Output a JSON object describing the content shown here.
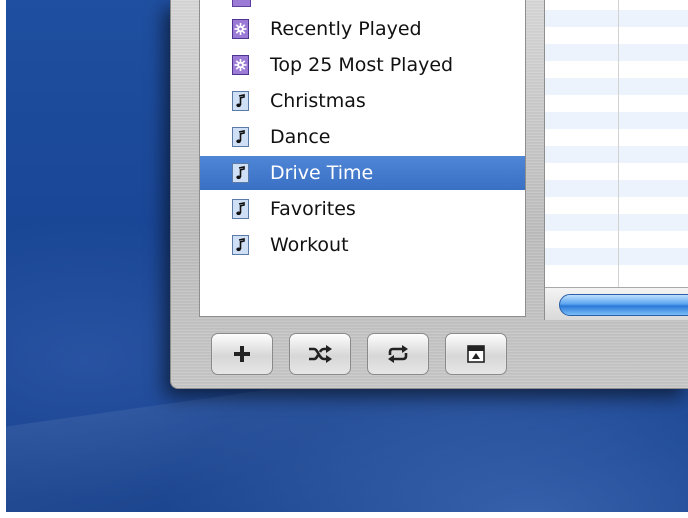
{
  "playlists": [
    {
      "label": "Recently Played",
      "icon": "smart-playlist-icon",
      "selected": false
    },
    {
      "label": "Top 25 Most Played",
      "icon": "smart-playlist-icon",
      "selected": false
    },
    {
      "label": "Christmas",
      "icon": "playlist-icon",
      "selected": false
    },
    {
      "label": "Dance",
      "icon": "playlist-icon",
      "selected": false
    },
    {
      "label": "Drive Time",
      "icon": "playlist-icon",
      "selected": true
    },
    {
      "label": "Favorites",
      "icon": "playlist-icon",
      "selected": false
    },
    {
      "label": "Workout",
      "icon": "playlist-icon",
      "selected": false
    }
  ],
  "toolbar": {
    "buttons": [
      {
        "name": "add-playlist-button",
        "icon": "plus-icon"
      },
      {
        "name": "shuffle-button",
        "icon": "shuffle-icon"
      },
      {
        "name": "repeat-button",
        "icon": "repeat-icon"
      },
      {
        "name": "artwork-button",
        "icon": "show-artwork-icon"
      }
    ]
  },
  "colors": {
    "selection": "#3a70c4",
    "desktop": "#1a4696",
    "smart_playlist": "#9c7bd6",
    "playlist_icon": "#cfe0f6"
  }
}
